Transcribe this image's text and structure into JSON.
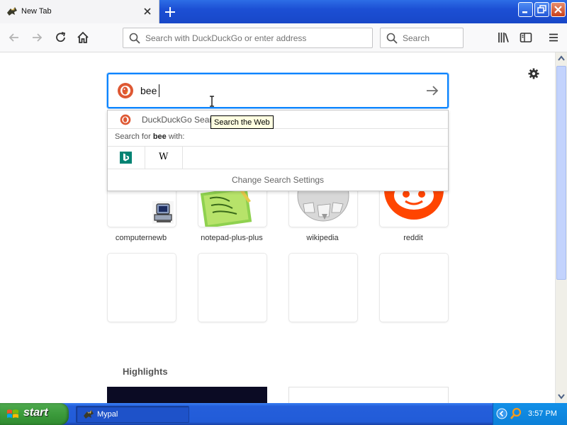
{
  "window": {
    "tab_title": "New Tab",
    "tab_favicon": "mypal-icon",
    "controls": [
      "minimize-icon",
      "restore-icon",
      "close-icon"
    ]
  },
  "toolbar": {
    "url_placeholder": "Search with DuckDuckGo or enter address",
    "search_placeholder": "Search",
    "icons": [
      "back-icon",
      "forward-icon",
      "reload-icon",
      "home-icon",
      "library-icon",
      "sidebar-icon",
      "menu-icon"
    ]
  },
  "page": {
    "search_value": "bee",
    "search_engine_icon": "duckduckgo-icon",
    "dropdown": {
      "suggestion_text": "DuckDuckGo Search",
      "search_for_prefix": "Search for ",
      "search_for_term": "bee",
      "search_for_suffix": " with:",
      "engines": [
        "bing-icon",
        "wikipedia-icon"
      ],
      "wiki_letter": "W",
      "change_settings": "Change Search Settings"
    },
    "tooltip": "Search the Web",
    "top_sites": [
      {
        "label": "computernewb",
        "icon": "computer-icon"
      },
      {
        "label": "notepad-plus-plus",
        "icon": "notepad-plus-plus-icon"
      },
      {
        "label": "wikipedia",
        "icon": "wikipedia-globe-icon"
      },
      {
        "label": "reddit",
        "icon": "reddit-icon"
      }
    ],
    "highlights_title": "Highlights"
  },
  "taskbar": {
    "start_label": "start",
    "task_label": "Mypal",
    "clock": "3:57 PM"
  },
  "colors": {
    "accent": "#0a84ff",
    "titlebar": "#1c4fd4",
    "taskbar": "#245edb",
    "start_green": "#3c9b3c",
    "ddg_orange": "#de5833",
    "reddit_orange": "#ff4500",
    "bing_teal": "#008373"
  }
}
